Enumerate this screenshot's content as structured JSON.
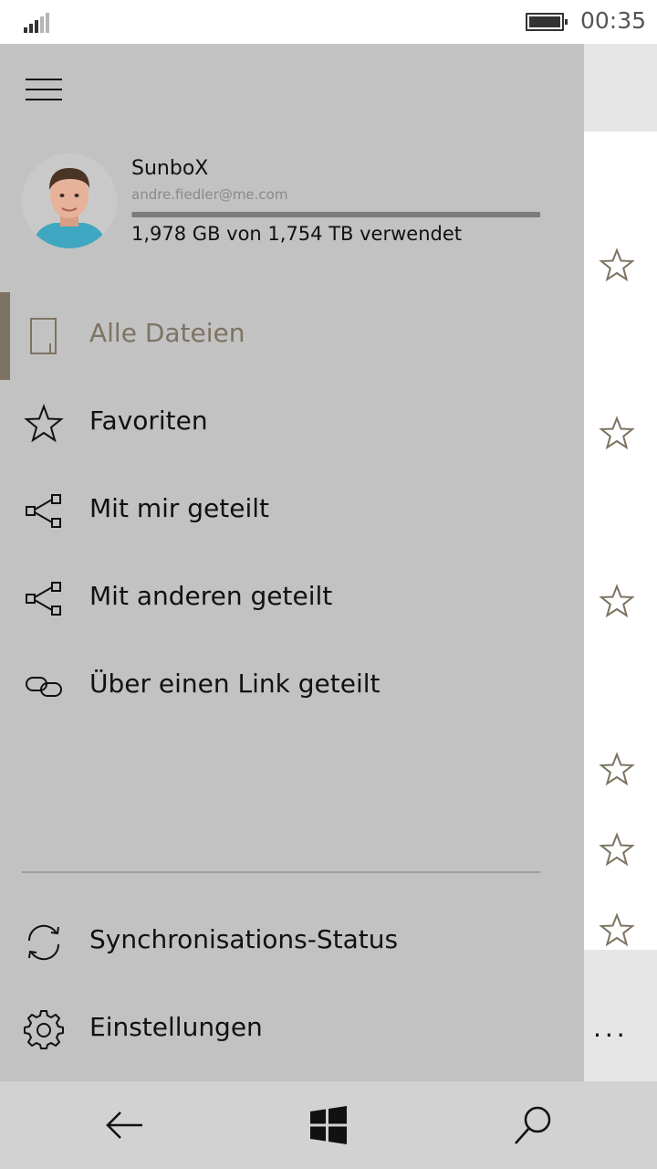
{
  "status_bar": {
    "time": "00:35",
    "signal_icon": "signal-strength-icon",
    "battery_icon": "battery-icon"
  },
  "drawer": {
    "menu_icon": "hamburger-menu-icon",
    "profile": {
      "name": "SunboX",
      "email": "andre.fiedler@me.com",
      "quota_text": "1,978 GB von 1,754 TB verwendet",
      "quota_used_fraction": 0.0011
    },
    "items": [
      {
        "label": "Alle Dateien",
        "icon": "file-icon",
        "active": true
      },
      {
        "label": "Favoriten",
        "icon": "star-icon",
        "active": false
      },
      {
        "label": "Mit mir geteilt",
        "icon": "share-icon",
        "active": false
      },
      {
        "label": "Mit anderen geteilt",
        "icon": "share-icon",
        "active": false
      },
      {
        "label": "Über einen Link geteilt",
        "icon": "link-icon",
        "active": false
      }
    ],
    "footer_items": [
      {
        "label": "Synchronisations-Status",
        "icon": "sync-icon"
      },
      {
        "label": "Einstellungen",
        "icon": "gear-icon"
      }
    ]
  },
  "background_app": {
    "more_label": "...",
    "star_icon": "star-outline-icon"
  },
  "nav_bar": {
    "back_icon": "back-arrow-icon",
    "home_icon": "windows-logo-icon",
    "search_icon": "search-icon"
  },
  "colors": {
    "accent": "#7d7363",
    "drawer_background": "#c2c2c2"
  }
}
